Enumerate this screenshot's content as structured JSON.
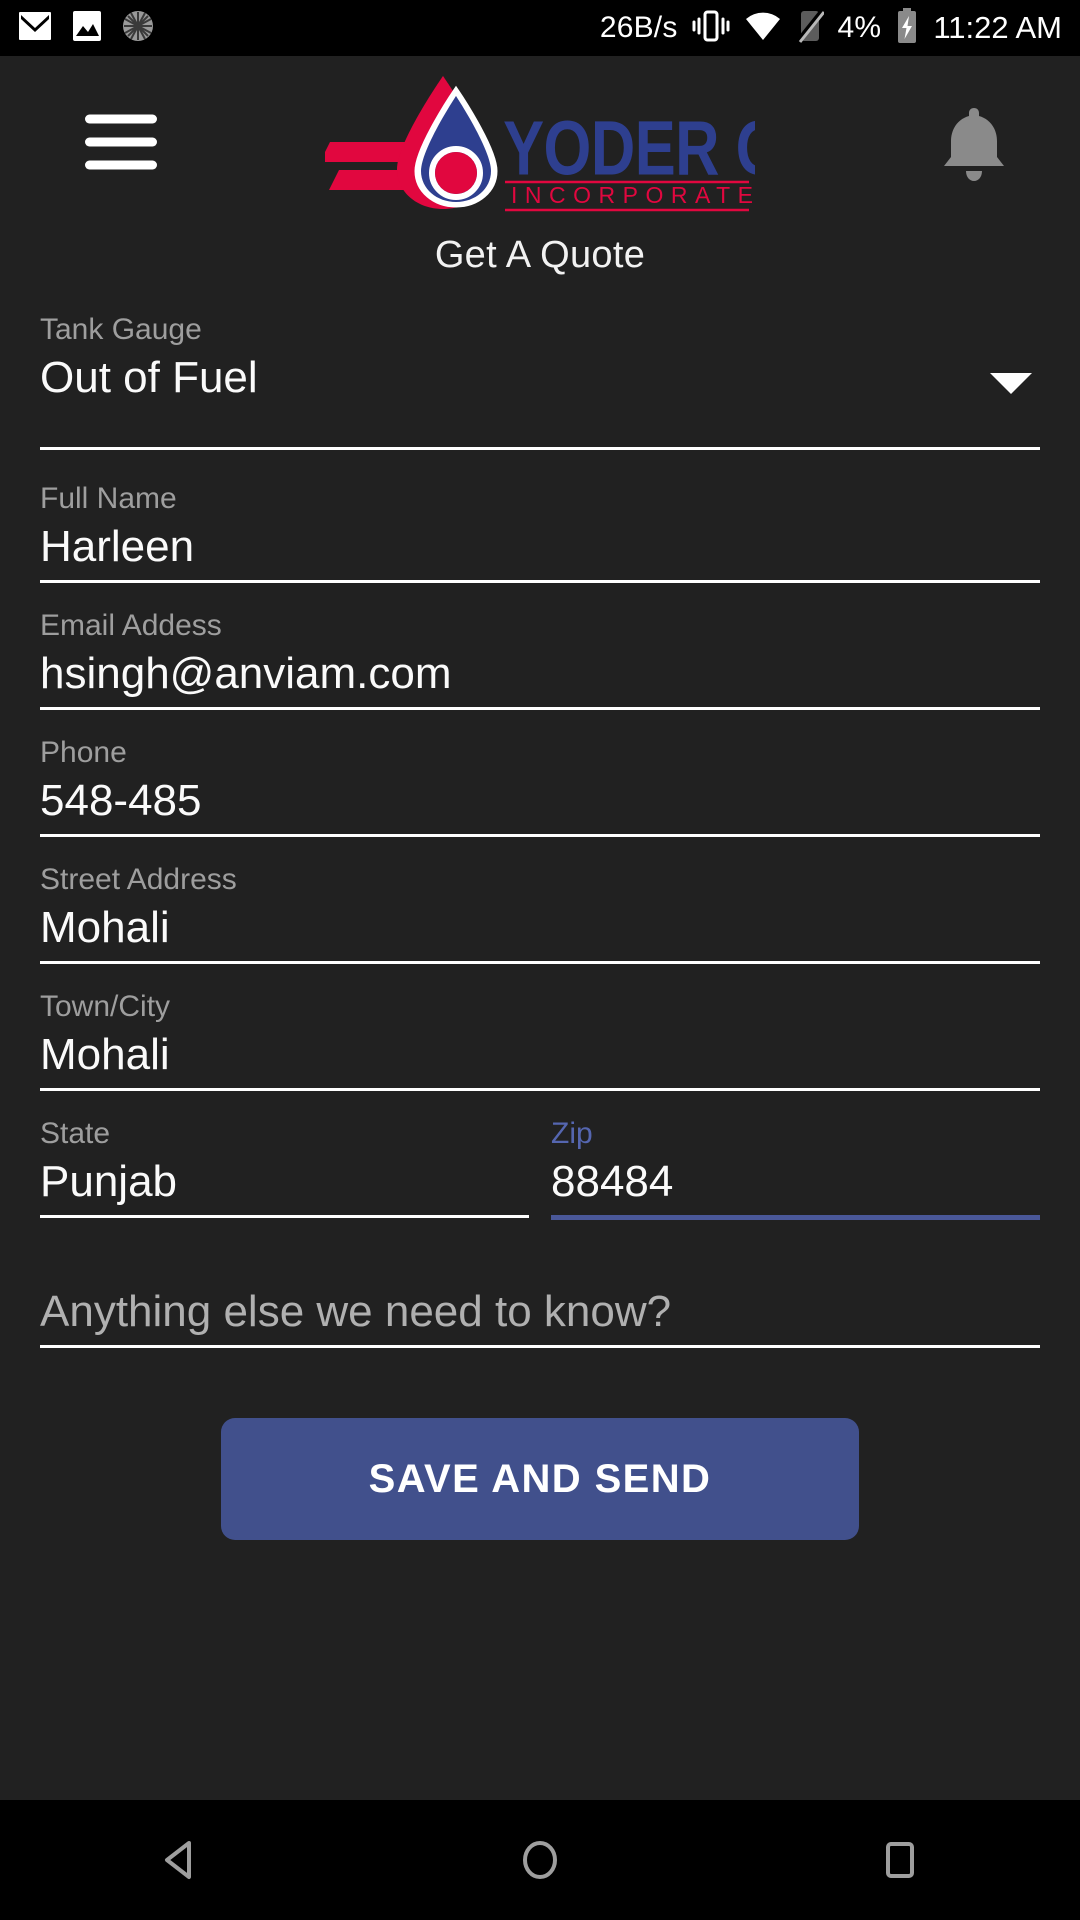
{
  "statusbar": {
    "icons_left": [
      "gmail-icon",
      "photos-icon",
      "loading-circle-icon"
    ],
    "network_speed": "26B/s",
    "icons_right": [
      "vibrate-icon",
      "wifi-icon",
      "no-sim-icon"
    ],
    "battery_percent": "4%",
    "battery_state": "charging",
    "time": "11:22 AM"
  },
  "appbar": {
    "menu_icon": "hamburger-menu-icon",
    "notification_icon": "bell-icon",
    "logo": {
      "brand": "YODER OIL",
      "subtitle": "INCORPORATED",
      "brand_color": "#2e3f8f",
      "accent_color": "#e1073f"
    }
  },
  "page": {
    "title": "Get A Quote"
  },
  "form": {
    "tank_gauge": {
      "label": "Tank Gauge",
      "value": "Out of Fuel",
      "caret_icon": "chevron-down-icon"
    },
    "fields": [
      {
        "name": "full-name",
        "label": "Full Name",
        "value": "Harleen",
        "focused": false
      },
      {
        "name": "email-address",
        "label": "Email Addess",
        "value": "hsingh@anviam.com",
        "focused": false
      },
      {
        "name": "phone",
        "label": "Phone",
        "value": "548-485",
        "focused": false
      },
      {
        "name": "street-address",
        "label": "Street Address",
        "value": "Mohali",
        "focused": false
      },
      {
        "name": "town-city",
        "label": "Town/City",
        "value": "Mohali",
        "focused": false
      }
    ],
    "state": {
      "label": "State",
      "value": "Punjab",
      "focused": false
    },
    "zip": {
      "label": "Zip",
      "value": "88484",
      "focused": true
    },
    "notes": {
      "placeholder": "Anything else we need to know?",
      "value": ""
    },
    "submit_label": "SAVE AND SEND",
    "focus_color": "#4a5899"
  },
  "navbar": {
    "back": "back-triangle-icon",
    "home": "home-circle-icon",
    "recents": "recents-square-icon"
  }
}
